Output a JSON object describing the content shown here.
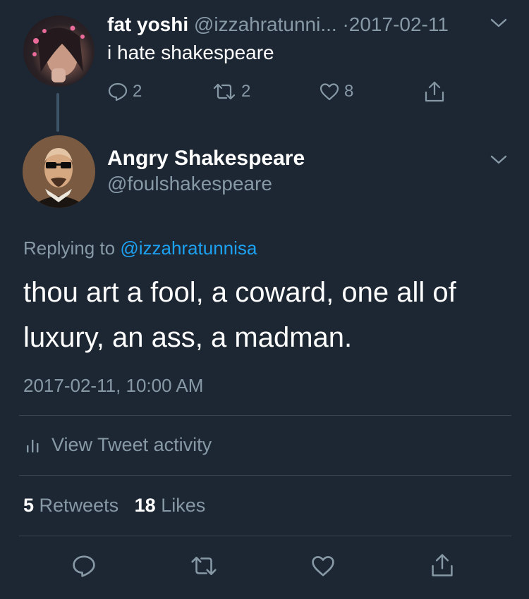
{
  "parent_tweet": {
    "name": "fat yoshi",
    "handle": "@izzahratunni...",
    "separator": "·",
    "date": "2017-02-11",
    "text": "i hate shakespeare",
    "reply_count": "2",
    "retweet_count": "2",
    "like_count": "8"
  },
  "main_tweet": {
    "name": "Angry Shakespeare",
    "handle": "@foulshakespeare",
    "replying_prefix": "Replying to",
    "replying_handle": "@izzahratunnisa",
    "text": "thou art a fool, a coward, one all of luxury, an ass, a madman.",
    "timestamp": "2017-02-11, 10:00 AM",
    "activity_label": "View Tweet activity",
    "retweets_count": "5",
    "retweets_label": "Retweets",
    "likes_count": "18",
    "likes_label": "Likes"
  },
  "colors": {
    "background": "#1c2733",
    "muted": "#8899a6",
    "link": "#1da1f2",
    "divider": "#38444d"
  },
  "icons": [
    "reply-icon",
    "retweet-icon",
    "like-icon",
    "share-icon",
    "chevron-down-icon",
    "bar-chart-icon"
  ]
}
